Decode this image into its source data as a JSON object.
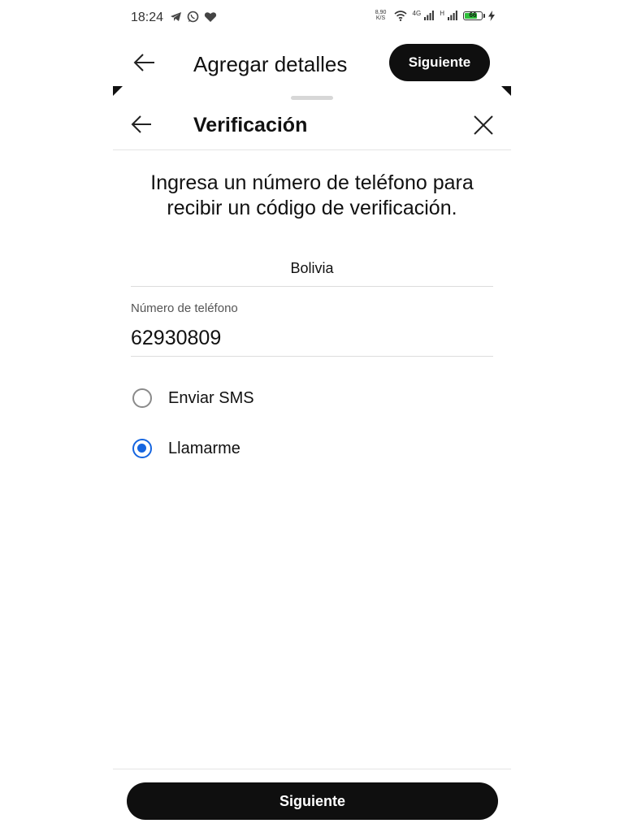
{
  "status_bar": {
    "time": "18:24",
    "left_icons": [
      "telegram-icon",
      "whatsapp-icon",
      "heart-icon"
    ],
    "net_speed_value": "8,90",
    "net_speed_unit": "K/S",
    "network_4g": "4G",
    "network_h": "H",
    "battery_level": "66",
    "battery_color": "#2fbf3b"
  },
  "app_bar": {
    "title": "Agregar detalles",
    "next_label": "Siguiente"
  },
  "sheet": {
    "title": "Verificación",
    "instructions": "Ingresa un número de teléfono para recibir un código de verificación.",
    "country": "Bolivia",
    "phone_label": "Número de teléfono",
    "phone_value": "62930809",
    "options": [
      {
        "label": "Enviar SMS",
        "selected": false
      },
      {
        "label": "Llamarme",
        "selected": true
      }
    ],
    "accent_color": "#1565e0",
    "next_label": "Siguiente"
  }
}
